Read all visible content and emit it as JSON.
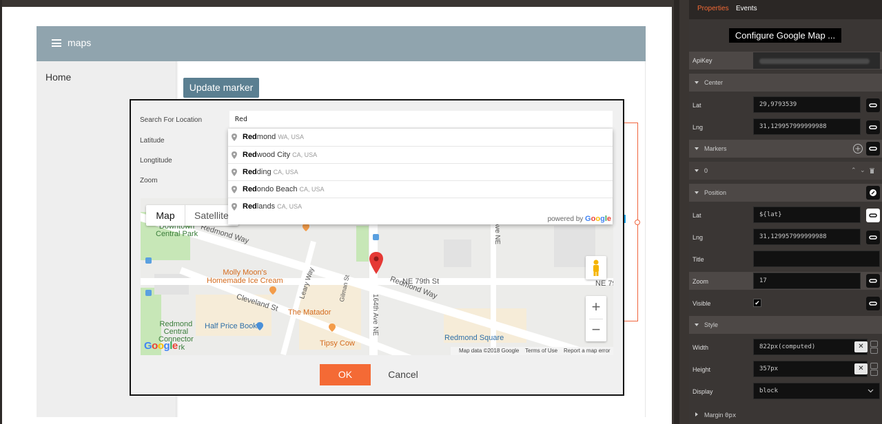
{
  "app": {
    "title": "maps",
    "nav_home": "Home",
    "update_marker_label": "Update marker"
  },
  "dialog": {
    "fields": {
      "search_label": "Search For Location",
      "search_value": "Red",
      "latitude_label": "Latitude",
      "longitude_label": "Longtitude",
      "zoom_label": "Zoom"
    },
    "autocomplete": [
      {
        "match": "Red",
        "rest": "mond",
        "secondary": "WA, USA"
      },
      {
        "match": "Red",
        "rest": "wood City",
        "secondary": "CA, USA"
      },
      {
        "match": "Red",
        "rest": "ding",
        "secondary": "CA, USA"
      },
      {
        "match": "Red",
        "rest": "ondo Beach",
        "secondary": "CA, USA"
      },
      {
        "match": "Red",
        "rest": "lands",
        "secondary": "CA, USA"
      }
    ],
    "powered_by": "powered by",
    "powered_brand": "Google",
    "ok_label": "OK",
    "cancel_label": "Cancel"
  },
  "map": {
    "map_tab": "Map",
    "satellite_tab": "Satellite",
    "labels": {
      "downtown_park": "Downtown\nCentral Park",
      "redmond_way_1": "Redmond Way",
      "redmond_way_2": "Redmond Way",
      "molly_moons": "Molly Moon's\nHomemade Ice Cream",
      "leary_way": "Leary Way",
      "gilman_st": "Gilman St",
      "cleveland_st": "Cleveland St",
      "the_matador": "The Matador",
      "ne_79th_st": "NE 79th St",
      "ne_79_right": "NE 79",
      "ave_164th": "164th Ave NE",
      "ave_16th": "16th Ave NE",
      "redmond_central_connector": "Redmond\nCentral\nConnector",
      "half_price_books": "Half Price Books",
      "tipsy_cow": "Tipsy Cow",
      "redmond_square": "Redmond Square",
      "park_suffix": "rk"
    },
    "logo": "Google",
    "zoom_in": "+",
    "zoom_out": "−",
    "footer": {
      "map_data": "Map data ©2018 Google",
      "terms": "Terms of Use",
      "report": "Report a map error"
    }
  },
  "panel": {
    "tabs": {
      "properties": "Properties",
      "events": "Events"
    },
    "title": "Configure Google Map ...",
    "apikey_label": "ApiKey",
    "center_label": "Center",
    "center_lat_label": "Lat",
    "center_lat_value": "29,9793539",
    "center_lng_label": "Lng",
    "center_lng_value": "31,129957999999988",
    "markers_label": "Markers",
    "marker_index": "0",
    "position_label": "Position",
    "pos_lat_label": "Lat",
    "pos_lat_value": "${lat}",
    "pos_lng_label": "Lng",
    "pos_lng_value": "31,129957999999988",
    "title_label": "Title",
    "zoom_label": "Zoom",
    "zoom_value": "17",
    "visible_label": "Visible",
    "visible_check": "✔",
    "style_label": "Style",
    "width_label": "Width",
    "width_value": "822px(computed)",
    "height_label": "Height",
    "height_value": "357px",
    "display_label": "Display",
    "display_value": "block",
    "margin_label": "Margin",
    "margin_value": "0px",
    "clear_glyph": "✕",
    "colors": {
      "accent": "#f46a35",
      "tab_active": "#f46a35"
    }
  }
}
